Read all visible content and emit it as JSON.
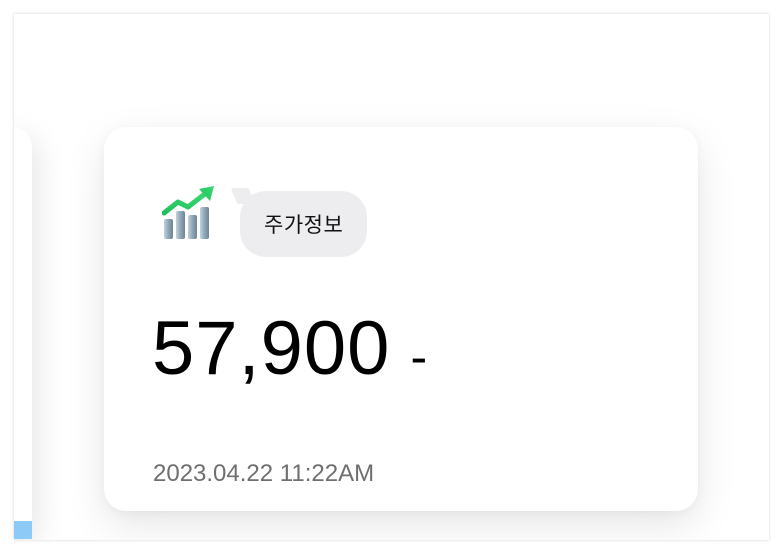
{
  "stock_card": {
    "label": "주가정보",
    "price": "57,900",
    "change": "-",
    "timestamp": "2023.04.22 11:22AM",
    "icon": "chart-increasing-icon"
  },
  "colors": {
    "card_background": "#ffffff",
    "bubble_background": "#ededef",
    "price_text": "#000000",
    "timestamp_text": "#6f6f72",
    "icon_arrow": "#22c55e",
    "icon_bars": "#9fb4c3",
    "scroll_marker": "#8ecaf7"
  }
}
